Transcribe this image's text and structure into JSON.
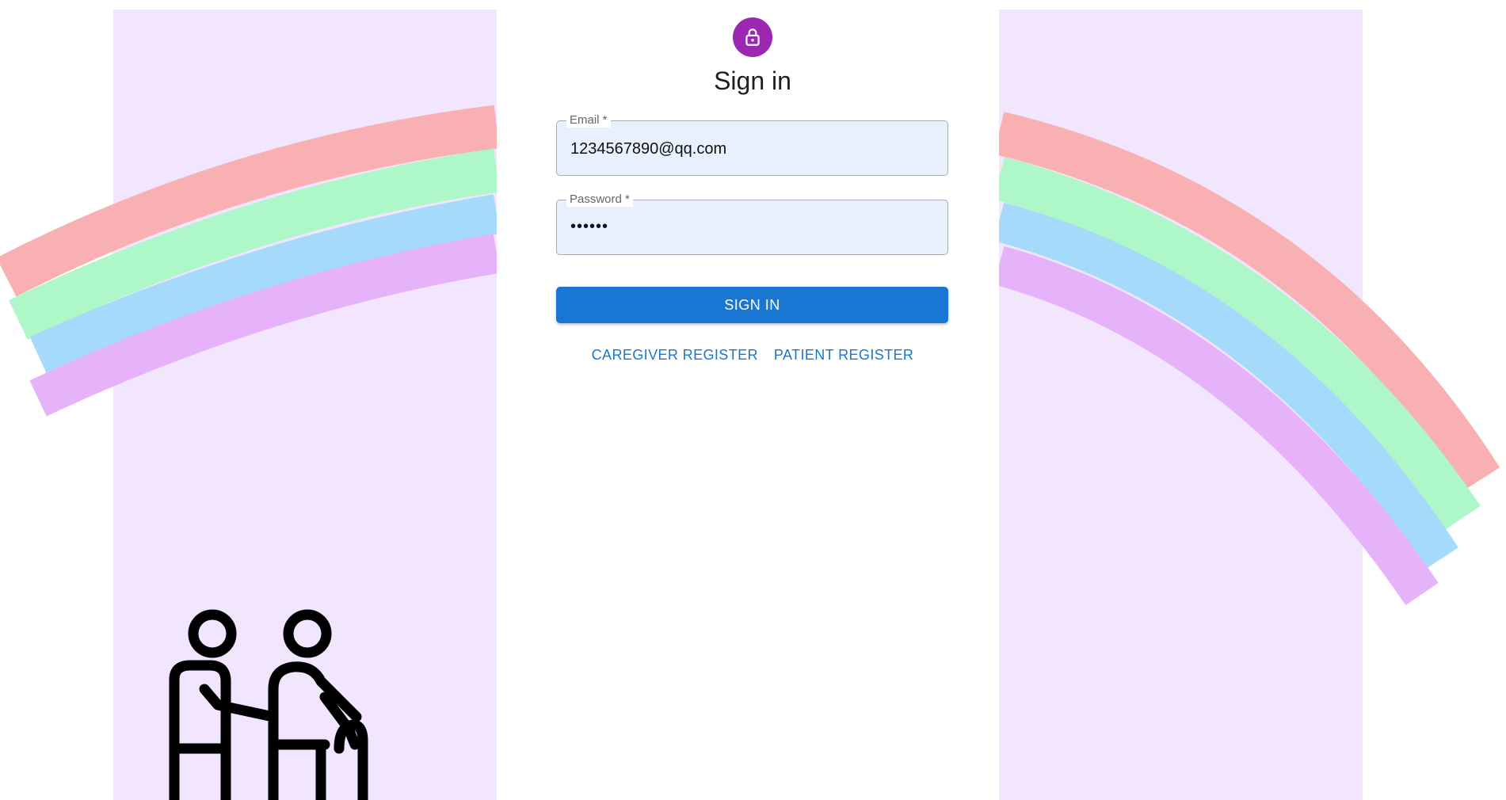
{
  "header": {
    "avatar_icon": "lock-icon",
    "avatar_color": "#9c27b0",
    "title": "Sign in"
  },
  "form": {
    "email": {
      "label": "Email *",
      "value": "1234567890@qq.com"
    },
    "password": {
      "label": "Password *",
      "value": "••••••"
    },
    "submit_label": "SIGN IN"
  },
  "links": {
    "caregiver_register": "CAREGIVER REGISTER",
    "patient_register": "PATIENT REGISTER"
  },
  "decor": {
    "illustration_icon": "elderly-with-caregiver-icon",
    "rainbow_colors": [
      "#f8b0b2",
      "#adf7c9",
      "#a5dafa",
      "#e6b3fa"
    ],
    "panel_color": "#f2e5fe",
    "accent": "#1976d2"
  }
}
